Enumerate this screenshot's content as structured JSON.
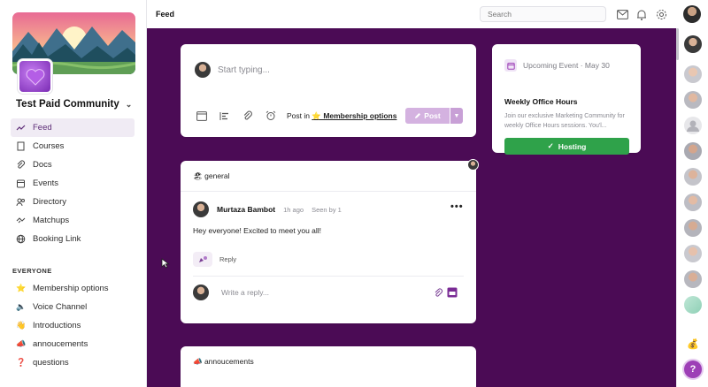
{
  "community": {
    "name": "Test Paid Community"
  },
  "sidebar": {
    "items": [
      {
        "label": "Feed",
        "icon": "trend-icon"
      },
      {
        "label": "Courses",
        "icon": "book-icon"
      },
      {
        "label": "Docs",
        "icon": "paperclip-icon"
      },
      {
        "label": "Events",
        "icon": "calendar-icon"
      },
      {
        "label": "Directory",
        "icon": "people-icon"
      },
      {
        "label": "Matchups",
        "icon": "handshake-icon"
      },
      {
        "label": "Booking Link",
        "icon": "globe-icon"
      }
    ],
    "section_label": "EVERYONE",
    "channels": [
      {
        "label": "Membership options",
        "emoji": "⭐"
      },
      {
        "label": "Voice Channel",
        "emoji": "🔈"
      },
      {
        "label": "Introductions",
        "emoji": "👋"
      },
      {
        "label": "annoucements",
        "emoji": "📣"
      },
      {
        "label": "questions",
        "emoji": "❓"
      }
    ]
  },
  "topbar": {
    "title": "Feed",
    "search_placeholder": "Search"
  },
  "composer": {
    "placeholder": "Start typing...",
    "post_in_prefix": "Post in",
    "post_in_channel": "⭐ Membership options",
    "post_label": "Post"
  },
  "event": {
    "header": "Upcoming Event · May 30",
    "title": "Weekly Office Hours",
    "description": "Join our exclusive Marketing Community for weekly Office Hours sessions. You'l...",
    "hosting_label": "Hosting"
  },
  "post": {
    "channel": "🏖 general",
    "author": "Murtaza Bambot",
    "time": "1h ago",
    "seen": "Seen by 1",
    "body": "Hey everyone! Excited to meet you all!",
    "reply_label": "Reply",
    "reply_placeholder": "Write a reply..."
  },
  "post2": {
    "channel": "📣 annoucements"
  },
  "colors": {
    "accent": "#4b0b55",
    "hosting": "#2fa24a",
    "post_button": "#d4b2e0",
    "help": "#9d3fb6"
  }
}
